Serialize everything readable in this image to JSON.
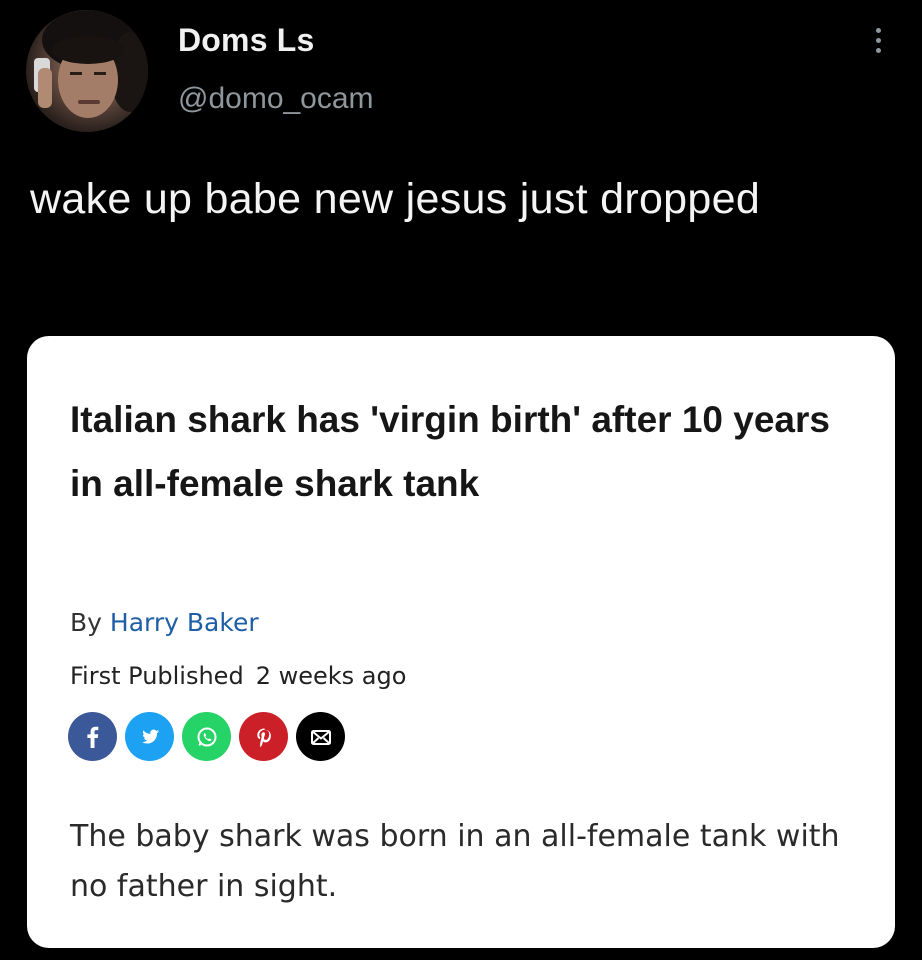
{
  "tweet": {
    "author_name": "Doms Ls",
    "author_handle": "@domo_ocam",
    "more_icon": "more-vertical-icon",
    "text": "wake up babe new jesus just dropped"
  },
  "article": {
    "headline": "Italian shark has 'virgin birth' after 10 years in all-female shark tank",
    "byline_prefix": "By",
    "author": "Harry Baker",
    "published_label": "First Published",
    "published_ago": "2 weeks ago",
    "share_buttons": [
      {
        "icon": "facebook-icon",
        "color": "#3b5998"
      },
      {
        "icon": "twitter-icon",
        "color": "#1da1f2"
      },
      {
        "icon": "whatsapp-icon",
        "color": "#25d366"
      },
      {
        "icon": "pinterest-icon",
        "color": "#cb2027"
      },
      {
        "icon": "email-icon",
        "color": "#000000"
      }
    ],
    "summary": "The baby shark was born in an all-female tank with no father in sight."
  }
}
